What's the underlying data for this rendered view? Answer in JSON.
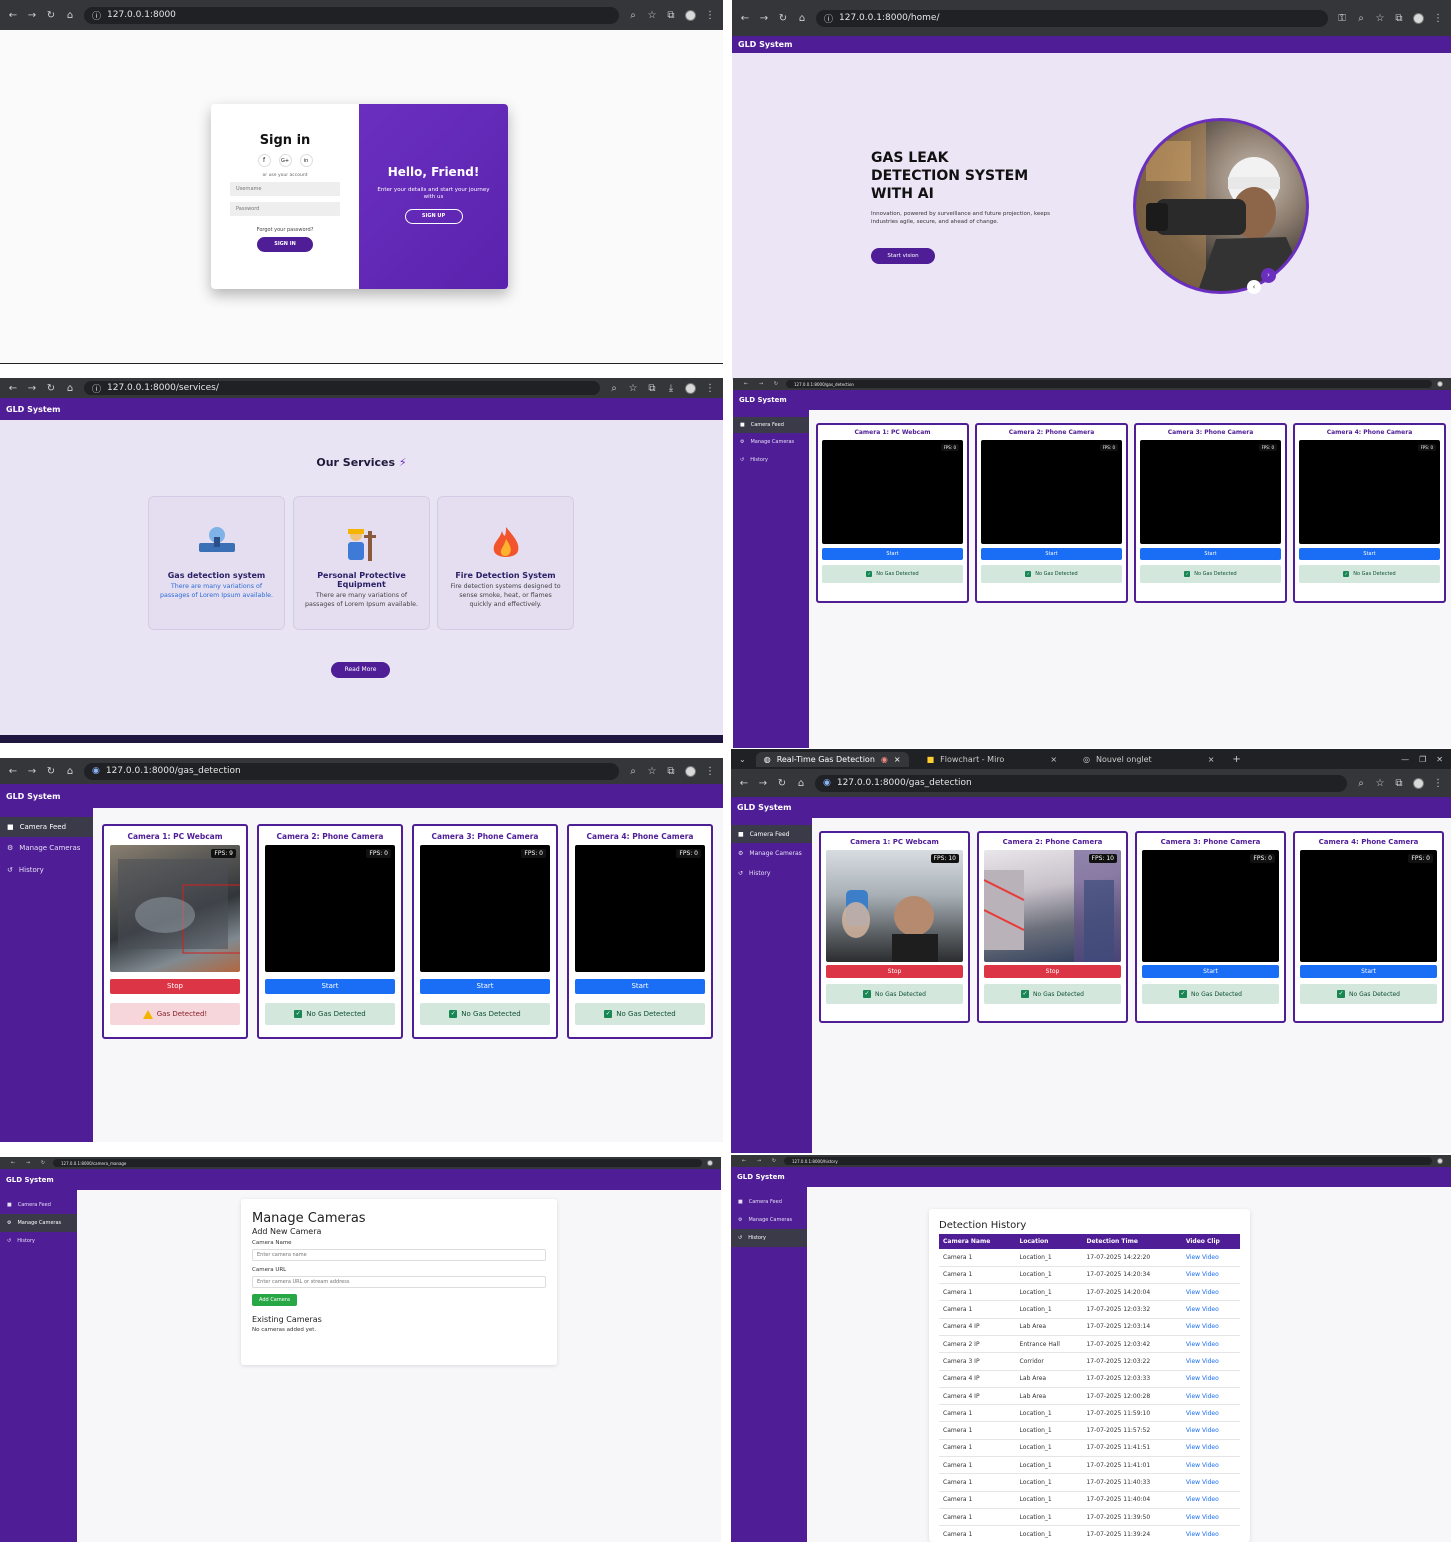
{
  "brand": "GLD System",
  "browser": {
    "url_login": "127.0.0.1:8000",
    "url_home": "127.0.0.1:8000/home/",
    "url_services": "127.0.0.1:8000/services/",
    "url_gas_small": "127.0.0.1:8000/gas_detection",
    "url_gas": "127.0.0.1:8000/gas_detection",
    "url_manage": "127.0.0.1:8000/camera_manage",
    "url_history": "127.0.0.1:8000/history",
    "tabs": [
      {
        "label": "Real-Time Gas Detection"
      },
      {
        "label": "Flowchart - Miro"
      },
      {
        "label": "Nouvel onglet"
      }
    ]
  },
  "login": {
    "title": "Sign in",
    "socials": [
      "f",
      "G+",
      "in"
    ],
    "or_text": "or use your account",
    "username_placeholder": "Username",
    "password_placeholder": "Password",
    "forgot": "Forgot your password?",
    "signin_button": "SIGN IN",
    "overlay_title": "Hello, Friend!",
    "overlay_text": "Enter your details and start your journey with us",
    "signup_button": "SIGN UP"
  },
  "home": {
    "headline_1": "GAS LEAK",
    "headline_2": "DETECTION SYSTEM",
    "headline_3": "WITH AI",
    "text": "Innovation, powered by surveillance and future projection, keeps industries agile, secure, and ahead of change.",
    "button": "Start vision"
  },
  "services": {
    "title": "Our Services",
    "cards": [
      {
        "title": "Gas detection system",
        "desc": "There are many variations of passages of Lorem Ipsum available."
      },
      {
        "title": "Personal Protective Equipment",
        "desc": "There are many variations of passages of Lorem Ipsum available."
      },
      {
        "title": "Fire Detection System",
        "desc": "Fire detection systems designed to sense smoke, heat, or flames quickly and effectively."
      }
    ],
    "button": "Read More"
  },
  "nav": {
    "camera_feed": "Camera Feed",
    "manage_cameras": "Manage Cameras",
    "history": "History"
  },
  "cameras": {
    "titles": [
      "Camera 1: PC Webcam",
      "Camera 2: Phone Camera",
      "Camera 3: Phone Camera",
      "Camera 4: Phone Camera"
    ],
    "fps0": "FPS: 0",
    "fps9": "FPS: 9",
    "fps10": "FPS: 10",
    "start": "Start",
    "stop": "Stop",
    "ok": "No Gas Detected",
    "bad": "Gas Detected!"
  },
  "manage": {
    "title": "Manage Cameras",
    "subtitle": "Add New Camera",
    "name_label": "Camera Name",
    "name_placeholder": "Enter camera name",
    "url_label": "Camera URL",
    "url_placeholder": "Enter camera URL or stream address",
    "add_button": "Add Camera",
    "existing_title": "Existing Cameras",
    "empty": "No cameras added yet."
  },
  "history": {
    "title": "Detection History",
    "columns": [
      "Camera Name",
      "Location",
      "Detection Time",
      "Video Clip"
    ],
    "link": "View Video",
    "rows": [
      [
        "Camera 1",
        "Location_1",
        "17-07-2025 14:22:20"
      ],
      [
        "Camera 1",
        "Location_1",
        "17-07-2025 14:20:34"
      ],
      [
        "Camera 1",
        "Location_1",
        "17-07-2025 14:20:04"
      ],
      [
        "Camera 1",
        "Location_1",
        "17-07-2025 12:03:32"
      ],
      [
        "Camera 4 IP",
        "Lab Area",
        "17-07-2025 12:03:14"
      ],
      [
        "Camera 2 IP",
        "Entrance Hall",
        "17-07-2025 12:03:42"
      ],
      [
        "Camera 3 IP",
        "Corridor",
        "17-07-2025 12:03:22"
      ],
      [
        "Camera 4 IP",
        "Lab Area",
        "17-07-2025 12:03:33"
      ],
      [
        "Camera 4 IP",
        "Lab Area",
        "17-07-2025 12:00:28"
      ],
      [
        "Camera 1",
        "Location_1",
        "17-07-2025 11:59:10"
      ],
      [
        "Camera 1",
        "Location_1",
        "17-07-2025 11:57:52"
      ],
      [
        "Camera 1",
        "Location_1",
        "17-07-2025 11:41:51"
      ],
      [
        "Camera 1",
        "Location_1",
        "17-07-2025 11:41:01"
      ],
      [
        "Camera 1",
        "Location_1",
        "17-07-2025 11:40:33"
      ],
      [
        "Camera 1",
        "Location_1",
        "17-07-2025 11:40:04"
      ],
      [
        "Camera 1",
        "Location_1",
        "17-07-2025 11:39:50"
      ],
      [
        "Camera 1",
        "Location_1",
        "17-07-2025 11:39:24"
      ]
    ]
  },
  "colors": {
    "brand": "#4f1d96",
    "lavender": "#e8e3f3",
    "start": "#1a6ef5",
    "stop": "#dc3545"
  }
}
